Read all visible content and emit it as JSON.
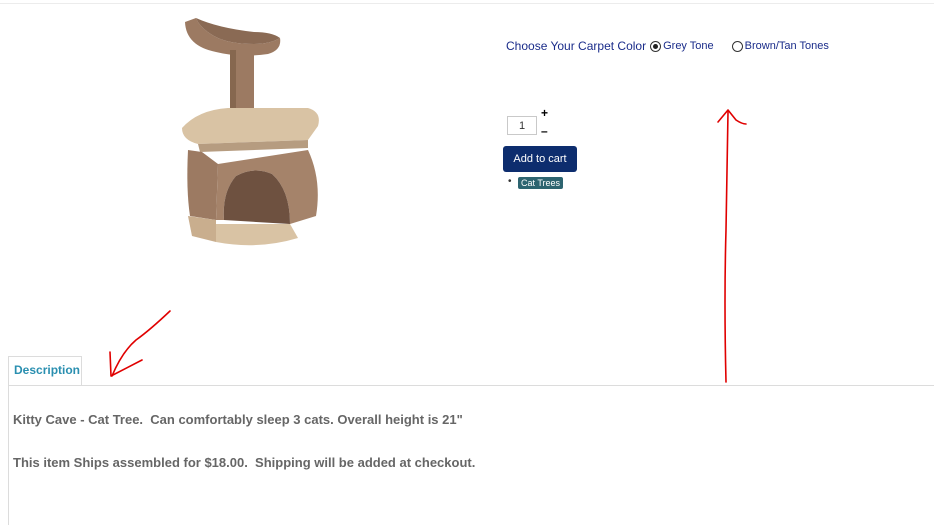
{
  "product": {
    "options_label": "Choose Your Carpet Color",
    "options": [
      {
        "label": "Grey Tone",
        "selected": true
      },
      {
        "label": "Brown/Tan Tones",
        "selected": false
      }
    ],
    "quantity": "1",
    "plus_label": "+",
    "minus_label": "–",
    "add_to_cart_label": "Add to cart",
    "category_bullet": "•",
    "category": "Cat Trees"
  },
  "tabs": [
    {
      "label": "Description",
      "active": true
    }
  ],
  "description": {
    "line1": "Kitty Cave - Cat Tree.  Can comfortably sleep 3 cats. Overall height is 21\"",
    "line2": "This item Ships assembled for $18.00.  Shipping will be added at checkout."
  },
  "colors": {
    "button_bg": "#0d2d6e",
    "option_text": "#1a2c8a",
    "tab_text": "#2a8fb0",
    "tag_bg": "#2d6470",
    "annotation": "#e00000",
    "carpet_brown": "#9c7a62",
    "carpet_beige": "#d9c3a4"
  }
}
